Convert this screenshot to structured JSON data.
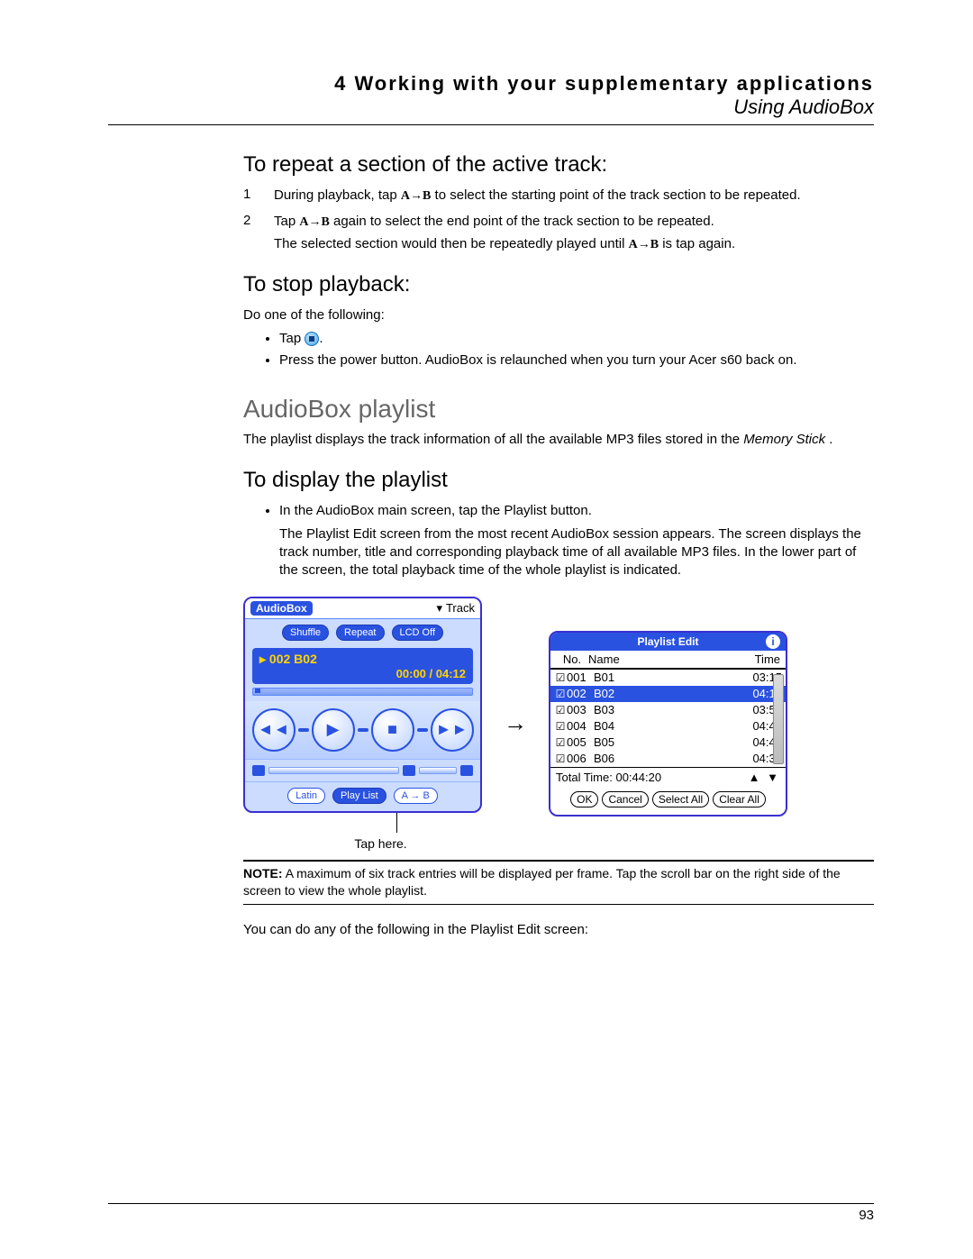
{
  "header": {
    "chapter": "4 Working with your supplementary applications",
    "subtitle": "Using AudioBox"
  },
  "sections": {
    "repeat_title": "To repeat a section of the active track:",
    "step1_num": "1",
    "step1_a": "During playback, tap ",
    "step1_ab": "A→B",
    "step1_b": " to select the starting point of the track section to be repeated.",
    "step2_num": "2",
    "step2_a": "Tap ",
    "step2_ab": "A→B",
    "step2_b": " again to select the end point of the track section to be repeated.",
    "step2_line2a": "The selected section would then be repeatedly played until ",
    "step2_line2_ab": "A→B",
    "step2_line2b": " is tap again.",
    "stop_title": "To stop playback:",
    "stop_intro": "Do one of the following:",
    "stop_b1": "Tap ",
    "stop_b2": "Press the power button. AudioBox is relaunched when you turn your Acer s60 back on.",
    "playlist_heading": "AudioBox playlist",
    "playlist_par_a": "The playlist displays the track information of all the available MP3 files stored in the ",
    "playlist_par_i": "Memory Stick",
    "playlist_par_b": ".",
    "display_title": "To display the playlist",
    "display_b1": "In the AudioBox main screen, tap the Playlist button.",
    "display_p": "The Playlist Edit screen from the most recent AudioBox session appears. The screen displays the track number, title and corresponding playback time of all available MP3 files. In the lower part of the screen, the total playback time of the whole playlist is indicated.",
    "tap_here": "Tap here.",
    "note_label": "NOTE:",
    "note_text": " A maximum of six track entries will be displayed per frame. Tap the scroll bar on the right side of the screen to view the whole playlist.",
    "after_note": "You can do any of the following in the Playlist Edit screen:"
  },
  "audiobox": {
    "logo": "AudioBox",
    "track_drop": "Track",
    "btn_shuffle": "Shuffle",
    "btn_repeat": "Repeat",
    "btn_lcdoff": "LCD Off",
    "track_title": "002 B02",
    "time_display": "00:00 / 04:12",
    "btn_latin": "Latin",
    "btn_playlist": "Play List",
    "btn_ab": "A → B"
  },
  "playlist": {
    "title": "Playlist Edit",
    "col_no": "No.",
    "col_name": "Name",
    "col_time": "Time",
    "rows": [
      {
        "no": "001",
        "name": "B01",
        "time": "03:15",
        "selected": false
      },
      {
        "no": "002",
        "name": "B02",
        "time": "04:12",
        "selected": true
      },
      {
        "no": "003",
        "name": "B03",
        "time": "03:57",
        "selected": false
      },
      {
        "no": "004",
        "name": "B04",
        "time": "04:48",
        "selected": false
      },
      {
        "no": "005",
        "name": "B05",
        "time": "04:44",
        "selected": false
      },
      {
        "no": "006",
        "name": "B06",
        "time": "04:31",
        "selected": false
      }
    ],
    "total_label": "Total Time: 00:44:20",
    "btn_ok": "OK",
    "btn_cancel": "Cancel",
    "btn_selectall": "Select All",
    "btn_clearall": "Clear All"
  },
  "page_number": "93"
}
